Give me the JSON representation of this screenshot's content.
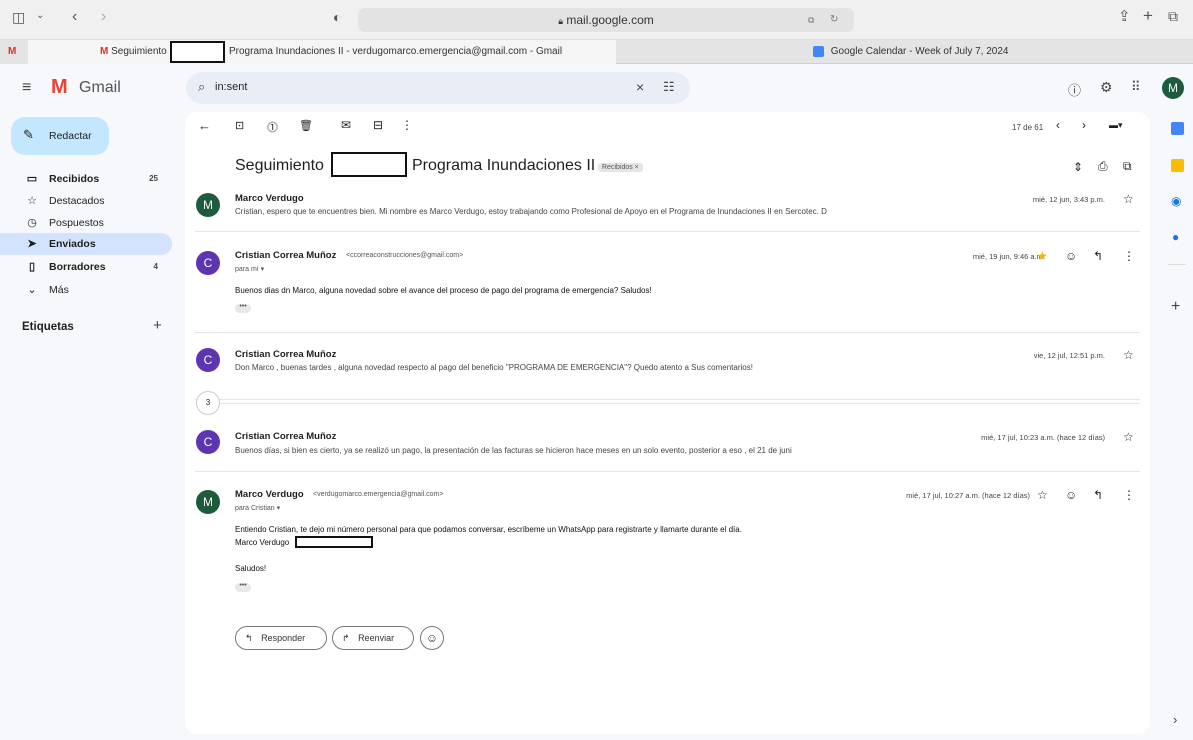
{
  "browser": {
    "url": "mail.google.com",
    "tabs": [
      {
        "label": "Seguimiento"
      },
      {
        "label": "Programa Inundaciones II - verdugomarco.emergencia@gmail.com - Gmail"
      },
      {
        "label": "Google Calendar - Week of July 7, 2024"
      }
    ]
  },
  "gmail": {
    "logo_text": "Gmail",
    "search_value": "in:sent",
    "avatar_letter": "M"
  },
  "sidebar": {
    "compose_label": "Redactar",
    "items": [
      {
        "label": "Recibidos",
        "count": "25",
        "icon": "inbox-icon"
      },
      {
        "label": "Destacados",
        "count": "",
        "icon": "star-icon"
      },
      {
        "label": "Pospuestos",
        "count": "",
        "icon": "clock-icon"
      },
      {
        "label": "Enviados",
        "count": "",
        "icon": "send-icon"
      },
      {
        "label": "Borradores",
        "count": "4",
        "icon": "draft-icon"
      },
      {
        "label": "Más",
        "count": "",
        "icon": "chevron-down-icon"
      }
    ],
    "labels_heading": "Etiquetas"
  },
  "toolbar": {
    "pagination": "17 de 61"
  },
  "thread": {
    "subject_a": "Seguimiento",
    "subject_b": "Programa Inundaciones II",
    "label_chip": "Recibidos ×",
    "collapsed_count": "3",
    "messages": [
      {
        "avatar": "M",
        "sender": "Marco Verdugo",
        "snippet": "Cristian, espero que te encuentres bien. Mi nombre es Marco Verdugo, estoy trabajando como Profesional de Apoyo en el Programa de Inundaciones II en Sercotec. D",
        "date": "mié, 12 jun, 3:43 p.m."
      },
      {
        "avatar": "C",
        "sender": "Cristian Correa Muñoz",
        "email": "<ccorreaconstrucciones@gmail.com>",
        "to": "para mí",
        "body": "Buenos dias dn Marco, alguna novedad sobre el avance del proceso de pago del programa de emergencia? Saludos!",
        "date": "mié, 19 jun, 9:46 a.m."
      },
      {
        "avatar": "C",
        "sender": "Cristian Correa Muñoz",
        "snippet": "Don Marco , buenas tardes , alguna novedad respecto al pago del beneficio \"PROGRAMA DE EMERGENCIA\"? Quedo atento a Sus comentarios!",
        "date": "vie, 12 jul, 12:51 p.m."
      },
      {
        "avatar": "C",
        "sender": "Cristian Correa Muñoz",
        "snippet": "Buenos días, si bien es cierto, ya se realizó un pago, la presentación de las facturas se hicieron hace meses en un solo evento, posterior a eso , el 21 de juni",
        "date": "mié, 17 jul, 10:23 a.m. (hace 12 días)"
      },
      {
        "avatar": "M",
        "sender": "Marco Verdugo",
        "email": "<verdugomarco.emergencia@gmail.com>",
        "to": "para Cristian",
        "body_line1": "Entiendo Cristian, te dejo mi número personal para que podamos conversar, escríbeme un WhatsApp para registrarte y llamarte durante el día.",
        "body_line2": "Marco Verdugo",
        "body_line3": "Saludos!",
        "date": "mié, 17 jul, 10:27 a.m. (hace 12 días)"
      }
    ],
    "reply_label": "Responder",
    "forward_label": "Reenviar"
  },
  "colors": {
    "compose_bg": "#c2e7ff",
    "selected_nav": "#d3e3fd",
    "avatar_green": "#1e5a3c",
    "avatar_purple": "#5e35b1",
    "star_gold": "#f6b400"
  }
}
